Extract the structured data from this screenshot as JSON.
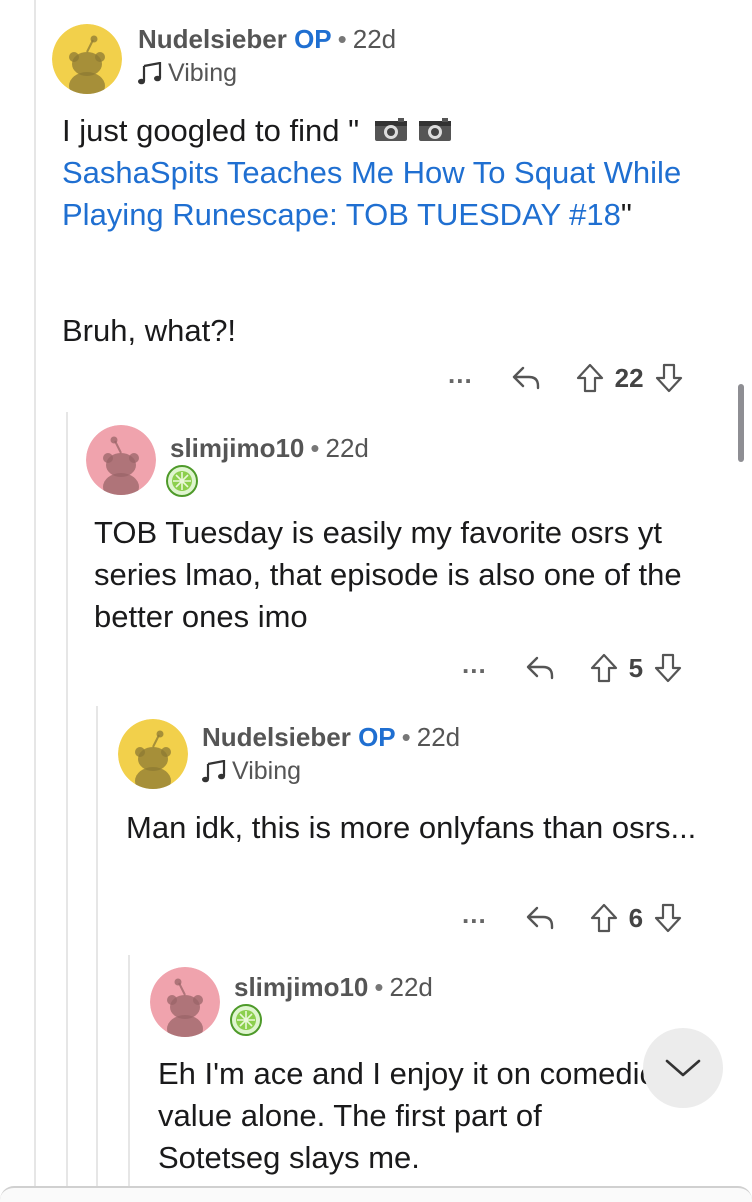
{
  "comments": [
    {
      "username": "Nudelsieber",
      "op_label": "OP",
      "separator": "•",
      "age": "22d",
      "flair": "Vibing",
      "flair_icon": "musical-notes-icon",
      "body_prefix": "I just googled to find \"",
      "body_link": "SashaSpits Teaches Me How To Squat While Playing Runescape: TOB TUESDAY #18",
      "body_suffix": "\"",
      "body_line2": "Bruh, what?!",
      "score": "22",
      "more_label": "...",
      "avatar_color": "#f2d04b"
    },
    {
      "username": "slimjimo10",
      "separator": "•",
      "age": "22d",
      "award_icon": "lime-award-icon",
      "body": "TOB Tuesday is easily my favorite osrs yt series lmao, that episode is also one of the better ones imo",
      "score": "5",
      "more_label": "...",
      "avatar_color": "#f0a3ad"
    },
    {
      "username": "Nudelsieber",
      "op_label": "OP",
      "separator": "•",
      "age": "22d",
      "flair": "Vibing",
      "flair_icon": "musical-notes-icon",
      "body": "Man idk, this is more onlyfans than osrs...",
      "score": "6",
      "more_label": "...",
      "avatar_color": "#f2d04b"
    },
    {
      "username": "slimjimo10",
      "separator": "•",
      "age": "22d",
      "award_icon": "lime-award-icon",
      "body": "Eh I'm ace and I enjoy it on comedic value alone. The first part of Sotetseg slays me.",
      "avatar_color": "#f0a3ad"
    }
  ],
  "colors": {
    "op": "#1f6fd1",
    "link": "#1f6fd1",
    "thread_line": "#e6e6e6"
  }
}
